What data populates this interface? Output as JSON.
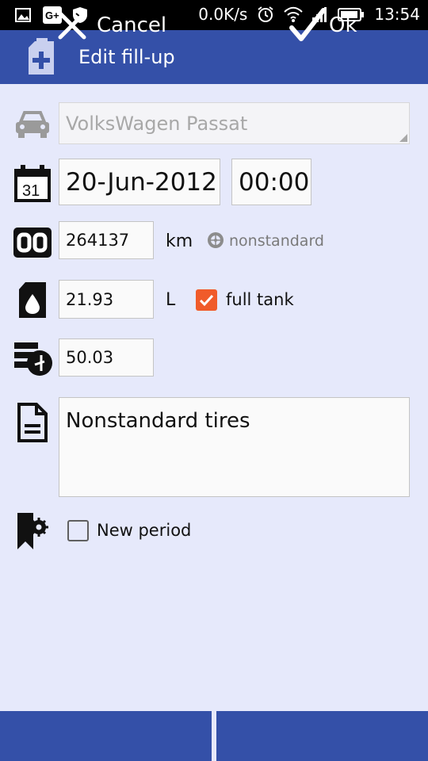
{
  "status_bar": {
    "speed": "0.0K/s",
    "time": "13:54"
  },
  "header": {
    "title": "Edit fill-up"
  },
  "form": {
    "vehicle": "VolksWagen Passat",
    "date": "20-Jun-2012",
    "time": "00:00",
    "odometer": "264137",
    "odometer_unit": "km",
    "tire_label": "nonstandard",
    "fuel_amount": "21.93",
    "fuel_unit": "L",
    "full_tank_label": "full tank",
    "full_tank_checked": true,
    "price": "50.03",
    "note": "Nonstandard tires",
    "new_period_label": "New period",
    "new_period_checked": false
  },
  "buttons": {
    "cancel": "Cancel",
    "ok": "Ok"
  },
  "colors": {
    "primary": "#3450a8",
    "background": "#e6e9fb",
    "accent": "#f05b2a"
  },
  "icons": [
    "gallery-icon",
    "google-plus-icon",
    "shield-icon",
    "alarm-icon",
    "wifi-icon",
    "signal-icon",
    "battery-icon",
    "fuel-can-plus-icon",
    "car-icon",
    "calendar-icon",
    "odometer-icon",
    "fuel-drop-icon",
    "price-icon",
    "document-icon",
    "bookmark-settings-icon",
    "close-icon",
    "check-icon"
  ]
}
